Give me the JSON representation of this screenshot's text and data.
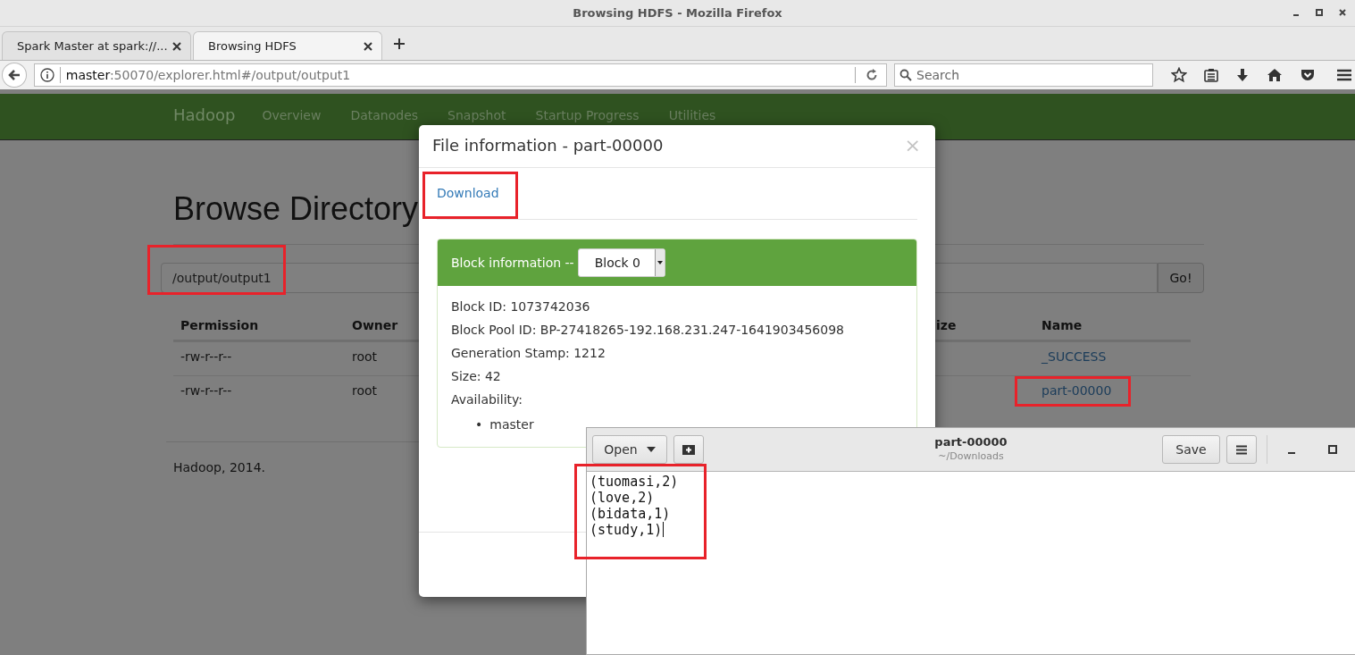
{
  "window": {
    "title": "Browsing HDFS - Mozilla Firefox"
  },
  "tabs": [
    {
      "label": "Spark Master at spark://...",
      "selected": false
    },
    {
      "label": "Browsing HDFS",
      "selected": true
    }
  ],
  "address_bar": {
    "host": "master",
    "path": ":50070/explorer.html#/output/output1"
  },
  "search": {
    "placeholder": "Search"
  },
  "site_nav": {
    "brand": "Hadoop",
    "items": [
      "Overview",
      "Datanodes",
      "Snapshot",
      "Startup Progress",
      "Utilities"
    ]
  },
  "browse": {
    "heading": "Browse Directory",
    "path_field": {
      "value": "/output/output1",
      "highlighted": true
    },
    "go_button": "Go!"
  },
  "table": {
    "columns": [
      "Permission",
      "Owner",
      "ize",
      "Name"
    ],
    "rows": [
      {
        "permission": "-rw-r--r--",
        "owner": "root",
        "name": "_SUCCESS",
        "highlighted": false
      },
      {
        "permission": "-rw-r--r--",
        "owner": "root",
        "name": "part-00000",
        "highlighted": true
      }
    ]
  },
  "footer": "Hadoop, 2014.",
  "modal": {
    "title": "File information - part-00000",
    "close": "×",
    "download": {
      "label": "Download",
      "highlighted": true
    },
    "panel_title": "Block information --",
    "block_select": "Block 0",
    "details": [
      "Block ID: 1073742036",
      "Block Pool ID: BP-27418265-192.168.231.247-1641903456098",
      "Generation Stamp: 1212",
      "Size: 42",
      "Availability:"
    ],
    "locations": [
      {
        "marker": "•",
        "text": "master"
      }
    ]
  },
  "editor": {
    "title": "part-00000",
    "subtitle": "~/Downloads",
    "open_button": "Open",
    "save_button": "Save",
    "highlighted": true,
    "lines": [
      "(tuomasi,2)",
      "(love,2)",
      "(bidata,1)",
      "(study,1)"
    ]
  }
}
